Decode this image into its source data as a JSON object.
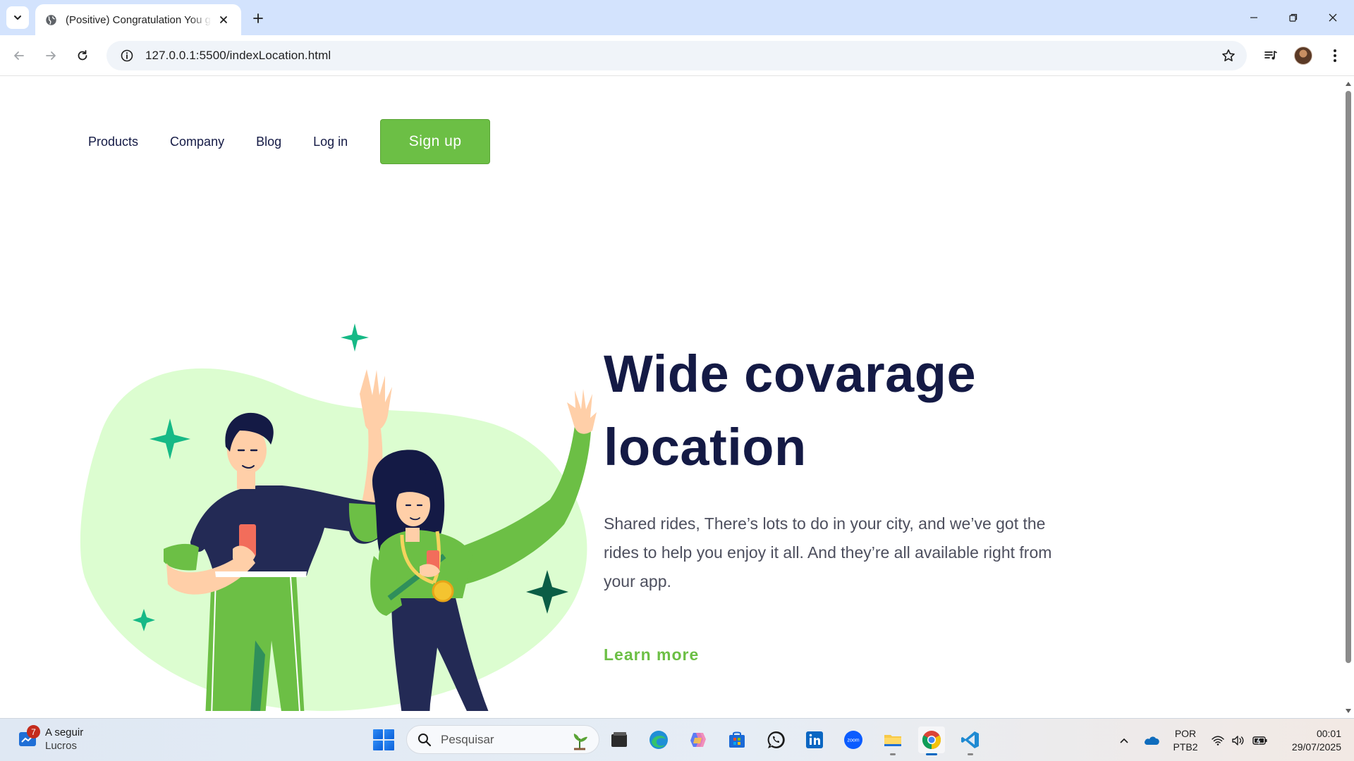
{
  "browser": {
    "tab_title": "(Positive) Congratulation You got",
    "url": "127.0.0.1:5500/indexLocation.html"
  },
  "page": {
    "nav": {
      "products": "Products",
      "company": "Company",
      "blog": "Blog",
      "login": "Log in",
      "signup": "Sign up"
    },
    "hero": {
      "title_line1": "Wide covarage",
      "title_line2": "location",
      "description": "Shared rides, There’s lots to do in your city, and we’ve got the rides to help you enjoy it all. And they’re all available right from your app.",
      "learn_more": "Learn more"
    },
    "colors": {
      "accent_green": "#6cbf45",
      "heading_navy": "#141a45",
      "blob_green": "#dcfdd0",
      "sparkle_teal": "#16b986",
      "sparkle_dark": "#0b5d46"
    }
  },
  "taskbar": {
    "widget_badge": "7",
    "widget_title": "A seguir",
    "widget_subtitle": "Lucros",
    "search_placeholder": "Pesquisar",
    "language": "POR",
    "keyboard": "PTB2",
    "time": "00:01",
    "date": "29/07/2025",
    "apps": [
      "file-explorer-dark-icon",
      "edge-icon",
      "copilot-icon",
      "store-icon",
      "whatsapp-icon",
      "linkedin-icon",
      "zoom-icon",
      "file-explorer-icon",
      "chrome-icon",
      "vscode-icon"
    ]
  }
}
